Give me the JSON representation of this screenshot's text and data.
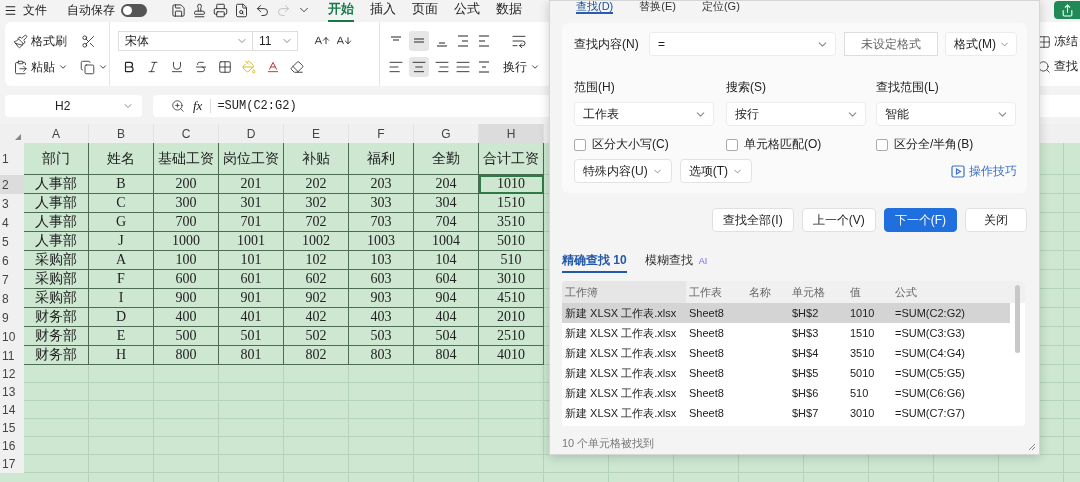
{
  "top_bar": {
    "file_menu": "文件",
    "autosave": {
      "label": "自动保存",
      "on": false
    },
    "tabs": [
      {
        "label": "开始",
        "selected": true
      },
      {
        "label": "插入",
        "selected": false
      },
      {
        "label": "页面",
        "selected": false
      },
      {
        "label": "公式",
        "selected": false
      },
      {
        "label": "数据",
        "selected": false
      }
    ]
  },
  "ribbon": {
    "format_painter": "格式刷",
    "paste": "粘贴",
    "font_name": "宋体",
    "font_size": "11",
    "wrap": "换行",
    "freeze": "冻结",
    "find": "查找"
  },
  "formula_bar": {
    "cell_name": "H2",
    "fx_label": "fx",
    "formula": "=SUM(C2:G2)"
  },
  "sheet": {
    "columns": [
      {
        "label": "A",
        "selected": false
      },
      {
        "label": "B",
        "selected": false
      },
      {
        "label": "C",
        "selected": false
      },
      {
        "label": "D",
        "selected": false
      },
      {
        "label": "E",
        "selected": false
      },
      {
        "label": "F",
        "selected": false
      },
      {
        "label": "G",
        "selected": false
      },
      {
        "label": "H",
        "selected": true
      }
    ],
    "rows": [
      {
        "number": "1",
        "kind": "header",
        "selected": false,
        "cells": [
          "部门",
          "姓名",
          "基础工资",
          "岗位工资",
          "补贴",
          "福利",
          "全勤",
          "合计工资"
        ]
      },
      {
        "number": "2",
        "kind": "data",
        "selected": true,
        "cells": [
          "人事部",
          "B",
          "200",
          "201",
          "202",
          "203",
          "204",
          "1010"
        ]
      },
      {
        "number": "3",
        "kind": "data",
        "selected": false,
        "cells": [
          "人事部",
          "C",
          "300",
          "301",
          "302",
          "303",
          "304",
          "1510"
        ]
      },
      {
        "number": "4",
        "kind": "data",
        "selected": false,
        "cells": [
          "人事部",
          "G",
          "700",
          "701",
          "702",
          "703",
          "704",
          "3510"
        ]
      },
      {
        "number": "5",
        "kind": "data",
        "selected": false,
        "cells": [
          "人事部",
          "J",
          "1000",
          "1001",
          "1002",
          "1003",
          "1004",
          "5010"
        ]
      },
      {
        "number": "6",
        "kind": "data",
        "selected": false,
        "cells": [
          "采购部",
          "A",
          "100",
          "101",
          "102",
          "103",
          "104",
          "510"
        ]
      },
      {
        "number": "7",
        "kind": "data",
        "selected": false,
        "cells": [
          "采购部",
          "F",
          "600",
          "601",
          "602",
          "603",
          "604",
          "3010"
        ]
      },
      {
        "number": "8",
        "kind": "data",
        "selected": false,
        "cells": [
          "采购部",
          "I",
          "900",
          "901",
          "902",
          "903",
          "904",
          "4510"
        ]
      },
      {
        "number": "9",
        "kind": "data",
        "selected": false,
        "cells": [
          "财务部",
          "D",
          "400",
          "401",
          "402",
          "403",
          "404",
          "2010"
        ]
      },
      {
        "number": "10",
        "kind": "data",
        "selected": false,
        "cells": [
          "财务部",
          "E",
          "500",
          "501",
          "502",
          "503",
          "504",
          "2510"
        ]
      },
      {
        "number": "11",
        "kind": "data",
        "selected": false,
        "cells": [
          "财务部",
          "H",
          "800",
          "801",
          "802",
          "803",
          "804",
          "4010"
        ]
      },
      {
        "number": "12",
        "kind": "empty",
        "selected": false
      },
      {
        "number": "13",
        "kind": "empty",
        "selected": false
      },
      {
        "number": "14",
        "kind": "empty",
        "selected": false
      },
      {
        "number": "15",
        "kind": "empty",
        "selected": false
      },
      {
        "number": "16",
        "kind": "empty",
        "selected": false
      },
      {
        "number": "17",
        "kind": "empty",
        "selected": false
      }
    ]
  },
  "dialog": {
    "tabs": [
      {
        "label": "查找(D)",
        "selected": true
      },
      {
        "label": "替换(E)",
        "selected": false
      },
      {
        "label": "定位(G)",
        "selected": false
      }
    ],
    "find_label": "查找内容(N)",
    "find_value": "=",
    "format_preview": "未设定格式",
    "format_button": "格式(M)",
    "options": [
      {
        "label": "范围(H)",
        "value": "工作表"
      },
      {
        "label": "搜索(S)",
        "value": "按行"
      },
      {
        "label": "查找范围(L)",
        "value": "智能"
      }
    ],
    "checkboxes": [
      {
        "label": "区分大小写(C)",
        "checked": false
      },
      {
        "label": "单元格匹配(O)",
        "checked": false
      },
      {
        "label": "区分全/半角(B)",
        "checked": false
      }
    ],
    "special_button": "特殊内容(U)",
    "options_button": "选项(T)",
    "tips_link": "操作技巧",
    "actions": [
      {
        "label": "查找全部(I)",
        "primary": false
      },
      {
        "label": "上一个(V)",
        "primary": false
      },
      {
        "label": "下一个(F)",
        "primary": true
      },
      {
        "label": "关闭",
        "primary": false
      }
    ],
    "result_tabs": [
      {
        "label": "精确查找",
        "count": "10",
        "selected": true
      },
      {
        "label": "模糊查找",
        "badge": "AI",
        "selected": false
      }
    ],
    "results": {
      "columns": [
        "工作簿",
        "工作表",
        "名称",
        "单元格",
        "值",
        "公式"
      ],
      "rows": [
        {
          "selected": true,
          "workbook": "新建 XLSX 工作表.xlsx",
          "sheet": "Sheet8",
          "cell": "$H$2",
          "value": "1010",
          "formula": "=SUM(C2:G2)"
        },
        {
          "selected": false,
          "workbook": "新建 XLSX 工作表.xlsx",
          "sheet": "Sheet8",
          "cell": "$H$3",
          "value": "1510",
          "formula": "=SUM(C3:G3)"
        },
        {
          "selected": false,
          "workbook": "新建 XLSX 工作表.xlsx",
          "sheet": "Sheet8",
          "cell": "$H$4",
          "value": "3510",
          "formula": "=SUM(C4:G4)"
        },
        {
          "selected": false,
          "workbook": "新建 XLSX 工作表.xlsx",
          "sheet": "Sheet8",
          "cell": "$H$5",
          "value": "5010",
          "formula": "=SUM(C5:G5)"
        },
        {
          "selected": false,
          "workbook": "新建 XLSX 工作表.xlsx",
          "sheet": "Sheet8",
          "cell": "$H$6",
          "value": "510",
          "formula": "=SUM(C6:G6)"
        },
        {
          "selected": false,
          "workbook": "新建 XLSX 工作表.xlsx",
          "sheet": "Sheet8",
          "cell": "$H$7",
          "value": "3010",
          "formula": "=SUM(C7:G7)"
        }
      ]
    },
    "status": "10 个单元格被找到"
  }
}
